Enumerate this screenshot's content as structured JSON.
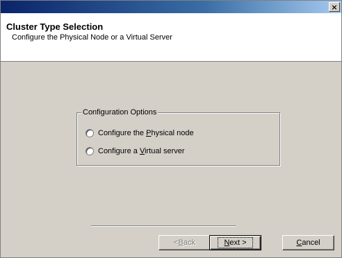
{
  "titlebar": {
    "close_glyph": "×"
  },
  "header": {
    "title": "Cluster Type Selection",
    "subtitle": "Configure the Physical Node or a Virtual Server"
  },
  "config_group": {
    "legend": "Configuration Options",
    "options": [
      {
        "prefix": "Configure the ",
        "accel": "P",
        "suffix": "hysical node",
        "selected": false
      },
      {
        "prefix": "Configure a ",
        "accel": "V",
        "suffix": "irtual server",
        "selected": false
      }
    ]
  },
  "buttons": {
    "back": {
      "prefix": "< ",
      "accel": "B",
      "suffix": "ack",
      "enabled": false
    },
    "next": {
      "accel": "N",
      "suffix": "ext >",
      "enabled": true
    },
    "cancel": {
      "accel": "C",
      "suffix": "ancel",
      "enabled": true
    }
  }
}
